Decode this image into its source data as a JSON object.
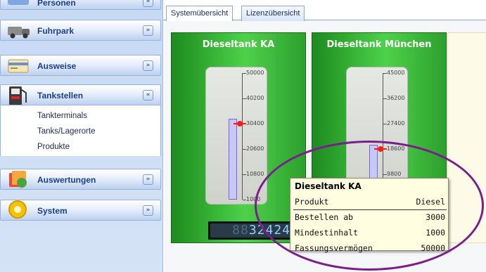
{
  "sidebar": {
    "groups": [
      {
        "label": "Personen",
        "icon": "persons-icon"
      },
      {
        "label": "Fuhrpark",
        "icon": "truck-icon"
      },
      {
        "label": "Ausweise",
        "icon": "id-card-icon"
      },
      {
        "label": "Tankstellen",
        "icon": "fuel-pump-icon",
        "expanded": true,
        "items": [
          "Tankterminals",
          "Tanks/Lagerorte",
          "Produkte"
        ]
      },
      {
        "label": "Auswertungen",
        "icon": "reports-icon"
      },
      {
        "label": "System",
        "icon": "system-gear-icon"
      }
    ],
    "collapse_glyph": "»",
    "expand_glyph": "«"
  },
  "tabs": [
    {
      "label": "Systemübersicht",
      "active": true
    },
    {
      "label": "Lizenzübersicht",
      "active": false
    }
  ],
  "tanks": [
    {
      "title": "Dieseltank KA",
      "scale": [
        "50000",
        "40200",
        "30400",
        "20600",
        "10800",
        "1000"
      ],
      "scale_max": 50000,
      "scale_min": 1000,
      "level_value": 32400,
      "order_marker": 30400,
      "lcd_dim": "88",
      "lcd_text": "32424"
    },
    {
      "title": "Dieseltank München",
      "scale": [
        "45000",
        "36200",
        "27400",
        "18600",
        "9800"
      ],
      "scale_max": 45000,
      "scale_min": 1000,
      "level_value": 20000,
      "order_marker": 18600
    }
  ],
  "tooltip": {
    "title": "Dieseltank KA",
    "header": {
      "label": "Produkt",
      "value": "Diesel"
    },
    "rows": [
      {
        "label": "Bestellen ab",
        "value": "3000"
      },
      {
        "label": "Mindestinhalt",
        "value": "1000"
      },
      {
        "label": "Fassungsvermögen",
        "value": "50000"
      }
    ]
  },
  "colors": {
    "panel_green": "#3fbf3d",
    "sidebar_blue": "#c6d9f3",
    "header_text": "#1b3f8a",
    "highlight_circle": "#7a1f8a",
    "marker_red": "#ff1a1a"
  }
}
